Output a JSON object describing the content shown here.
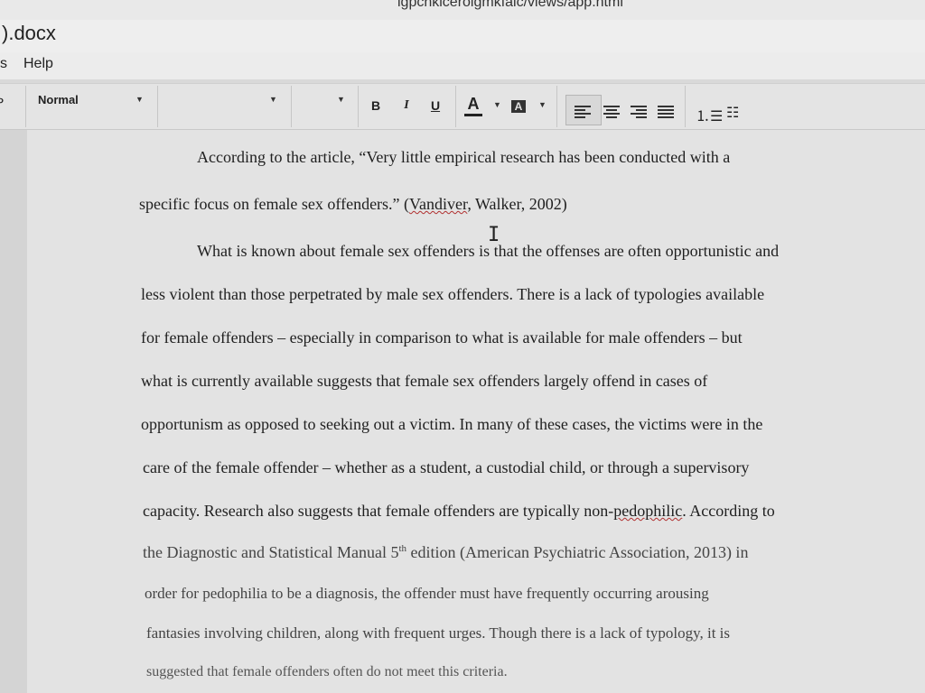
{
  "browser": {
    "url_fragment": "igpcnkicerolgmkfaic/views/app.html"
  },
  "document": {
    "title": ").docx"
  },
  "menu": {
    "partial_left": "s",
    "help": "Help"
  },
  "toolbar": {
    "style_value": "Normal",
    "bold": "B",
    "italic": "I",
    "underline": "U",
    "font_color": "A",
    "highlight": "A"
  },
  "body": {
    "lines": [
      "According to the article, “Very little empirical research has been conducted with a",
      "specific focus on female sex offenders.” (",
      "Vandiver",
      ", Walker, 2002)",
      "What is known about female sex offenders is that the offenses are often opportunistic and",
      "less violent than those perpetrated by male sex offenders. There is a lack of typologies available",
      "for female offenders – especially in comparison to what is available for male offenders – but",
      "what is currently available suggests that female sex offenders largely offend in cases of",
      "opportunism as opposed to seeking out a victim. In many of these cases, the victims were in the",
      "care of the female offender – whether as a student, a custodial child, or through a supervisory",
      "capacity. Research also suggests that female offenders are typically non-",
      "pedophilic",
      ". According to",
      "the Diagnostic and Statistical Manual 5",
      "th",
      " edition (American Psychiatric Association, 2013) in",
      "order for pedophilia to be a diagnosis, the offender must have frequently occurring arousing",
      "fantasies involving children, along with frequent urges. Though there is a lack of typology, it is",
      "suggested that female offenders often do not meet this criteria."
    ]
  }
}
